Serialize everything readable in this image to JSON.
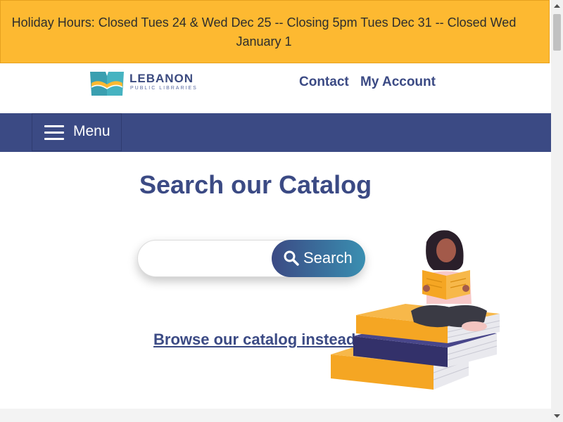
{
  "alert": {
    "text": "Holiday Hours: Closed Tues 24 & Wed Dec 25 -- Closing 5pm Tues Dec 31 -- Closed Wed January 1"
  },
  "header": {
    "logo_title": "LEBANON",
    "logo_subtitle": "PUBLIC LIBRARIES",
    "contact_label": "Contact",
    "account_label": "My Account"
  },
  "nav": {
    "menu_label": "Menu",
    "menu_icon": "hamburger-icon"
  },
  "main": {
    "title": "Search our Catalog",
    "search": {
      "value": "",
      "placeholder": "",
      "button_label": "Search",
      "button_icon": "search-icon"
    },
    "browse_label": "Browse our catalog instead"
  },
  "colors": {
    "alert_bg": "#fdb931",
    "brand_blue": "#3b4a84",
    "accent_teal": "#3a8fb1",
    "book_yellow": "#f5a623"
  }
}
